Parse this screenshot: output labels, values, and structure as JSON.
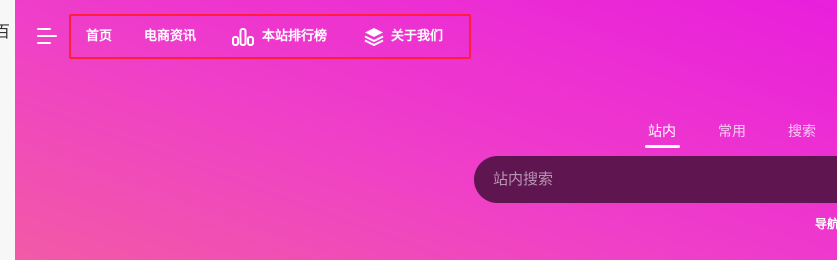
{
  "sidebar": {
    "fragment": "百"
  },
  "header": {
    "nav": [
      {
        "label": "首页",
        "icon": null
      },
      {
        "label": "电商资讯",
        "icon": null
      },
      {
        "label": "本站排行榜",
        "icon": "bar-chart-icon"
      },
      {
        "label": "关于我们",
        "icon": "layers-icon"
      }
    ]
  },
  "search": {
    "tabs": [
      "站内",
      "常用",
      "搜索"
    ],
    "active_tab": "站内",
    "placeholder": "站内搜索",
    "value": ""
  },
  "footer_link": {
    "label": "导航"
  },
  "colors": {
    "gradient_start": "#f25aa6",
    "gradient_end": "#e91fdc",
    "search_bg": "#5e1550",
    "highlight_border": "#ff1f3d"
  }
}
